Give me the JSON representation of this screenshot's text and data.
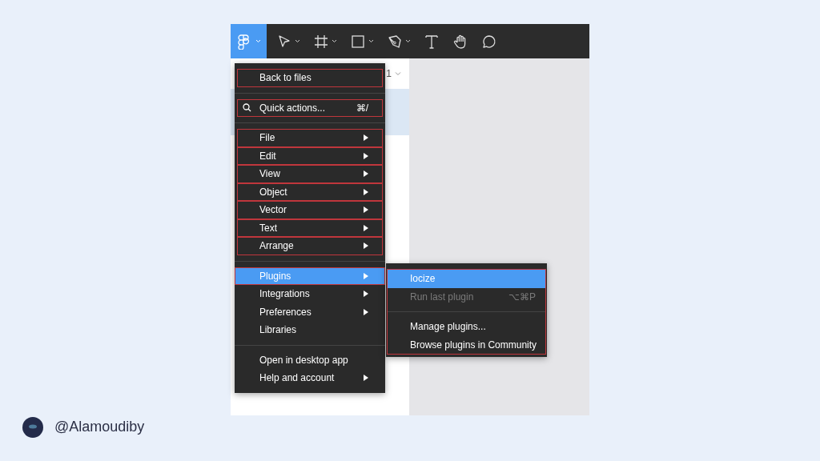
{
  "toolbar": {
    "tools": [
      {
        "kind": "logo",
        "has_menu": true,
        "selected": true
      },
      {
        "kind": "move",
        "has_menu": true,
        "selected": false
      },
      {
        "kind": "frame",
        "has_menu": true,
        "selected": false
      },
      {
        "kind": "rectangle",
        "has_menu": true,
        "selected": false
      },
      {
        "kind": "pen",
        "has_menu": true,
        "selected": false
      },
      {
        "kind": "text",
        "has_menu": false,
        "selected": false
      },
      {
        "kind": "hand",
        "has_menu": false,
        "selected": false
      },
      {
        "kind": "comment",
        "has_menu": false,
        "selected": false
      }
    ]
  },
  "layers_panel": {
    "page_label": "1"
  },
  "main_menu": {
    "groups": [
      [
        {
          "label": "Back to files",
          "submenu": false,
          "selected": false,
          "outlined": true
        }
      ],
      [
        {
          "label": "Quick actions...",
          "kind": "search",
          "shortcut": "⌘/",
          "submenu": false,
          "selected": false,
          "outlined": true
        }
      ],
      [
        {
          "label": "File",
          "submenu": true,
          "selected": false,
          "outlined": true
        },
        {
          "label": "Edit",
          "submenu": true,
          "selected": false,
          "outlined": true
        },
        {
          "label": "View",
          "submenu": true,
          "selected": false,
          "outlined": true
        },
        {
          "label": "Object",
          "submenu": true,
          "selected": false,
          "outlined": true
        },
        {
          "label": "Vector",
          "submenu": true,
          "selected": false,
          "outlined": true
        },
        {
          "label": "Text",
          "submenu": true,
          "selected": false,
          "outlined": true
        },
        {
          "label": "Arrange",
          "submenu": true,
          "selected": false,
          "outlined": true
        }
      ],
      [
        {
          "label": "Plugins",
          "submenu": true,
          "selected": true,
          "outlined": true
        },
        {
          "label": "Integrations",
          "submenu": true,
          "selected": false,
          "outlined": false
        },
        {
          "label": "Preferences",
          "submenu": true,
          "selected": false,
          "outlined": false
        },
        {
          "label": "Libraries",
          "submenu": false,
          "selected": false,
          "outlined": false
        }
      ],
      [
        {
          "label": "Open in desktop app",
          "submenu": false,
          "selected": false,
          "outlined": false
        },
        {
          "label": "Help and account",
          "submenu": true,
          "selected": false,
          "outlined": false
        }
      ]
    ]
  },
  "plugins_submenu": {
    "outlined": true,
    "groups": [
      [
        {
          "label": "Iocize",
          "selected": true,
          "disabled": false
        },
        {
          "label": "Run last plugin",
          "shortcut": "⌥⌘P",
          "selected": false,
          "disabled": true
        }
      ],
      [
        {
          "label": "Manage plugins...",
          "selected": false,
          "disabled": false
        },
        {
          "label": "Browse plugins in Community",
          "selected": false,
          "disabled": false
        }
      ]
    ]
  },
  "author": {
    "handle": "@Alamoudiby"
  }
}
